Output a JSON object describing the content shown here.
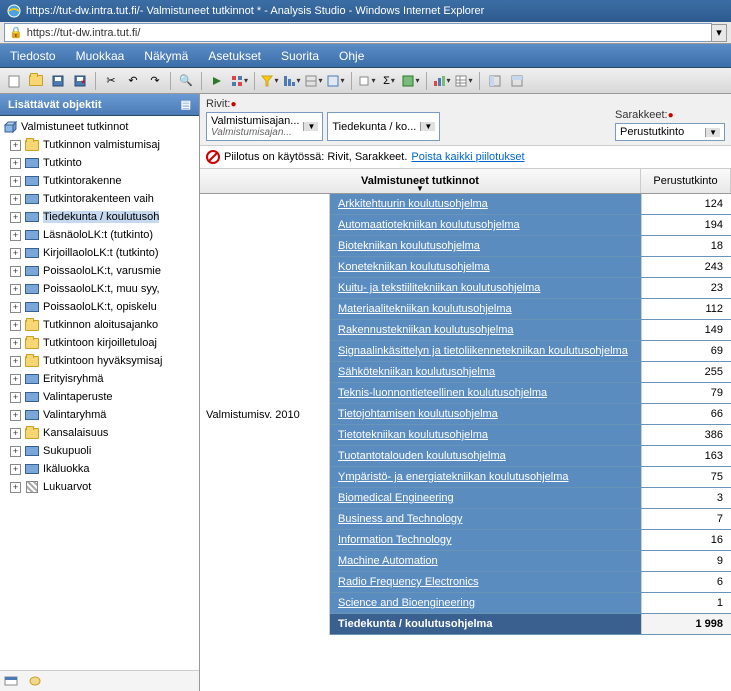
{
  "window": {
    "url": "https://tut-dw.intra.tut.fi/",
    "title_suffix": " - Valmistuneet tutkinnot * - Analysis Studio - Windows Internet Explorer"
  },
  "menu": [
    "Tiedosto",
    "Muokkaa",
    "Näkymä",
    "Asetukset",
    "Suorita",
    "Ohje"
  ],
  "sidebar": {
    "title": "Lisättävät objektit",
    "root": "Valmistuneet tutkinnot",
    "nodes": [
      {
        "icon": "folder",
        "label": "Tutkinnon valmistumisaj"
      },
      {
        "icon": "dim",
        "label": "Tutkinto"
      },
      {
        "icon": "dim",
        "label": "Tutkintorakenne"
      },
      {
        "icon": "dim",
        "label": "Tutkintorakenteen vaih"
      },
      {
        "icon": "dim",
        "label": "Tiedekunta / koulutusoh",
        "selected": true
      },
      {
        "icon": "dim",
        "label": "LäsnäoloLK:t (tutkinto)"
      },
      {
        "icon": "dim",
        "label": "KirjoillaoloLK:t (tutkinto)"
      },
      {
        "icon": "dim",
        "label": "PoissaoloLK:t, varusmie"
      },
      {
        "icon": "dim",
        "label": "PoissaoloLK:t, muu syy,"
      },
      {
        "icon": "dim",
        "label": "PoissaoloLK:t, opiskelu"
      },
      {
        "icon": "folder",
        "label": "Tutkinnon aloitusajanko"
      },
      {
        "icon": "folder",
        "label": "Tutkintoon kirjoilletuloaj"
      },
      {
        "icon": "folder",
        "label": "Tutkintoon hyväksymisaj"
      },
      {
        "icon": "dim",
        "label": "Erityisryhmä"
      },
      {
        "icon": "dim",
        "label": "Valintaperuste"
      },
      {
        "icon": "dim",
        "label": "Valintaryhmä"
      },
      {
        "icon": "folder",
        "label": "Kansalaisuus"
      },
      {
        "icon": "dim",
        "label": "Sukupuoli"
      },
      {
        "icon": "dim",
        "label": "Ikäluokka"
      },
      {
        "icon": "measure",
        "label": "Lukuarvot"
      }
    ]
  },
  "filters": {
    "rows_label": "Rivit:",
    "cols_label": "Sarakkeet:",
    "row1": {
      "main": "Valmistumisajan...",
      "sub": "Valmistumisajan..."
    },
    "row2": {
      "main": "Tiedekunta / ko..."
    },
    "col1": {
      "main": "Perustutkinto"
    }
  },
  "hide_bar": {
    "text": "Piilotus on käytössä: Rivit, Sarakkeet.",
    "link": "Poista kaikki piilotukset"
  },
  "grid": {
    "main_header": "Valmistuneet tutkinnot",
    "value_header": "Perustutkinto",
    "row_group": "Valmistumisv. 2010",
    "rows": [
      {
        "label": "Arkkitehtuurin koulutusohjelma",
        "value": 124
      },
      {
        "label": "Automaatiotekniikan koulutusohjelma",
        "value": 194
      },
      {
        "label": "Biotekniikan koulutusohjelma",
        "value": 18
      },
      {
        "label": "Konetekniikan koulutusohjelma",
        "value": 243
      },
      {
        "label": "Kuitu- ja tekstiilitekniikan koulutusohjelma",
        "value": 23
      },
      {
        "label": "Materiaalitekniikan koulutusohjelma",
        "value": 112
      },
      {
        "label": "Rakennustekniikan koulutusohjelma",
        "value": 149
      },
      {
        "label": "Signaalinkäsittelyn ja tietoliikennetekniikan koulutusohjelma",
        "value": 69
      },
      {
        "label": "Sähkötekniikan koulutusohjelma",
        "value": 255
      },
      {
        "label": "Teknis-luonnontieteellinen koulutusohjelma",
        "value": 79
      },
      {
        "label": "Tietojohtamisen koulutusohjelma",
        "value": 66
      },
      {
        "label": "Tietotekniikan koulutusohjelma",
        "value": 386
      },
      {
        "label": "Tuotantotalouden koulutusohjelma",
        "value": 163
      },
      {
        "label": "Ympäristö- ja energiatekniikan koulutusohjelma",
        "value": 75
      },
      {
        "label": "Biomedical Engineering",
        "value": 3
      },
      {
        "label": "Business and Technology",
        "value": 7
      },
      {
        "label": "Information Technology",
        "value": 16
      },
      {
        "label": "Machine Automation",
        "value": 9
      },
      {
        "label": "Radio Frequency Electronics",
        "value": 6
      },
      {
        "label": "Science and Bioengineering",
        "value": 1
      }
    ],
    "total": {
      "label": "Tiedekunta / koulutusohjelma",
      "value": "1 998"
    }
  }
}
